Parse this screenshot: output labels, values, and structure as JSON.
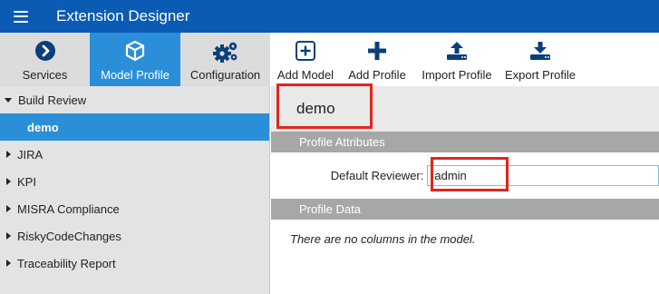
{
  "app": {
    "title": "Extension Designer"
  },
  "icons": {
    "menu": "hamburger-icon",
    "services": "chevron-circle-right-icon",
    "model_profile": "cube-icon",
    "configuration": "gears-icon",
    "add_model": "plus-square-icon",
    "add_profile": "plus-icon",
    "import_profile": "upload-icon",
    "export_profile": "download-icon"
  },
  "tabs": [
    {
      "label": "Services",
      "active": false
    },
    {
      "label": "Model Profile",
      "active": true
    },
    {
      "label": "Configuration",
      "active": false
    }
  ],
  "toolbar": {
    "add_model": "Add Model",
    "add_profile": "Add Profile",
    "import_profile": "Import Profile",
    "export_profile": "Export Profile"
  },
  "tree": {
    "items": [
      {
        "label": "Build Review",
        "expanded": true
      },
      {
        "label": "demo",
        "selected": true
      },
      {
        "label": "JIRA"
      },
      {
        "label": "KPI"
      },
      {
        "label": "MISRA Compliance"
      },
      {
        "label": "RiskyCodeChanges"
      },
      {
        "label": "Traceability Report"
      }
    ]
  },
  "profile": {
    "name": "demo",
    "attributes_title": "Profile Attributes",
    "default_reviewer_label": "Default Reviewer:",
    "default_reviewer_value": "admin",
    "data_title": "Profile Data",
    "empty_message": "There are no columns in the model."
  },
  "colors": {
    "titlebar": "#0b5bb5",
    "active": "#2a8fd8",
    "highlight": "#e3251b",
    "section": "#a7a7a7"
  }
}
